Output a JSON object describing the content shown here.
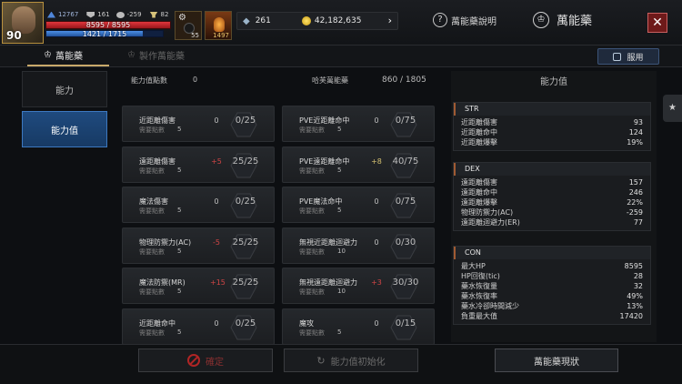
{
  "hud": {
    "level": "90",
    "stat1": "12767",
    "stat2": "161",
    "stat3": "-259",
    "stat4": "82",
    "hp_text": "8595 / 8595",
    "mp_text": "1421 / 1715",
    "hp_fraction": 1.0,
    "mp_fraction": 0.83,
    "quick1_count": "55",
    "quick2_count": "1497",
    "gems": "261",
    "gold": "42,182,635",
    "help_label": "萬能藥說明",
    "title": "萬能藥"
  },
  "tabs": {
    "active": "萬能藥",
    "inactive": "製作萬能藥",
    "equip_label": "服用"
  },
  "leftnav": [
    "能力",
    "能力值"
  ],
  "center": {
    "points_label": "能力值點數",
    "points_value": "0",
    "count_label": "哈芙萬能藥",
    "count_value": "860 / 1805",
    "require_label": "需要點數",
    "cards": [
      {
        "name": "近距離傷害",
        "req": "5",
        "val": "0",
        "cap": "0/25",
        "sign": "zero"
      },
      {
        "name": "PVE近距離命中",
        "req": "5",
        "val": "0",
        "cap": "0/75",
        "sign": "zero"
      },
      {
        "name": "遠距離傷害",
        "req": "5",
        "val": "+5",
        "cap": "25/25",
        "sign": "plus"
      },
      {
        "name": "PVE遠距離命中",
        "req": "5",
        "val": "+8",
        "cap": "40/75",
        "sign": "pos"
      },
      {
        "name": "魔法傷害",
        "req": "5",
        "val": "0",
        "cap": "0/25",
        "sign": "zero"
      },
      {
        "name": "PVE魔法命中",
        "req": "5",
        "val": "0",
        "cap": "0/75",
        "sign": "zero"
      },
      {
        "name": "物理防禦力(AC)",
        "req": "5",
        "val": "-5",
        "cap": "25/25",
        "sign": "minus"
      },
      {
        "name": "無視近距離迴避力",
        "req": "10",
        "val": "0",
        "cap": "0/30",
        "sign": "zero"
      },
      {
        "name": "魔法防禦(MR)",
        "req": "5",
        "val": "+15",
        "cap": "25/25",
        "sign": "plus"
      },
      {
        "name": "無視遠距離迴避力",
        "req": "10",
        "val": "+3",
        "cap": "30/30",
        "sign": "plus"
      },
      {
        "name": "近距離命中",
        "req": "5",
        "val": "0",
        "cap": "0/25",
        "sign": "zero"
      },
      {
        "name": "魔攻",
        "req": "5",
        "val": "0",
        "cap": "0/15",
        "sign": "zero"
      }
    ]
  },
  "right": {
    "title": "能力值",
    "sections": [
      {
        "head": "STR",
        "rows": [
          {
            "k": "近距離傷害",
            "v": "93"
          },
          {
            "k": "近距離命中",
            "v": "124"
          },
          {
            "k": "近距離爆擊",
            "v": "19%"
          }
        ]
      },
      {
        "head": "DEX",
        "rows": [
          {
            "k": "遠距離傷害",
            "v": "157"
          },
          {
            "k": "遠距離命中",
            "v": "246"
          },
          {
            "k": "遠距離爆擊",
            "v": "22%"
          },
          {
            "k": "物理防禦力(AC)",
            "v": "-259"
          },
          {
            "k": "遠距離迴避力(ER)",
            "v": "77"
          }
        ]
      },
      {
        "head": "CON",
        "rows": [
          {
            "k": "最大HP",
            "v": "8595"
          },
          {
            "k": "HP回復(tic)",
            "v": "28"
          },
          {
            "k": "藥水恢復量",
            "v": "32"
          },
          {
            "k": "藥水恢復率",
            "v": "49%"
          },
          {
            "k": "藥水冷卻時間減少",
            "v": "13%"
          },
          {
            "k": "負重最大值",
            "v": "17420"
          }
        ]
      }
    ]
  },
  "bottom": {
    "btn1": "確定",
    "btn2": "能力值初始化",
    "btn3": "萬能藥現狀"
  }
}
